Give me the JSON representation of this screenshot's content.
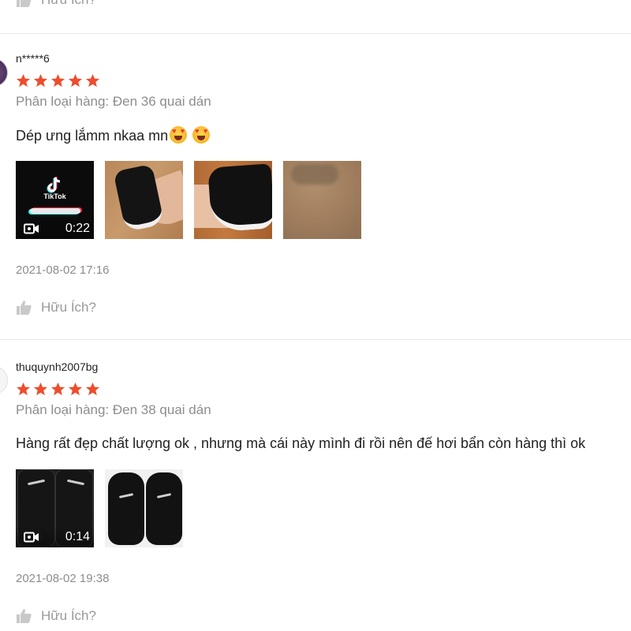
{
  "helpful_label": "Hữu Ích?",
  "reviews": [
    {
      "username": "n*****6",
      "rating": 5,
      "variant": "Phân loại hàng: Đen 36 quai dán",
      "comment": "Dép ưng lắmm nkaa mn",
      "media": [
        {
          "kind": "video",
          "duration": "0:22",
          "logo_text": "TikTok"
        },
        {
          "kind": "photo"
        },
        {
          "kind": "photo"
        },
        {
          "kind": "photo"
        }
      ],
      "date": "2021-08-02 17:16"
    },
    {
      "username": "thuquynh2007bg",
      "rating": 5,
      "variant": "Phân loại hàng: Đen 38 quai dán",
      "comment": "Hàng rất đẹp chất lượng ok , nhưng mà cái này mình đi rồi nên đế hơi bẩn còn hàng thì ok",
      "media": [
        {
          "kind": "video",
          "duration": "0:14"
        },
        {
          "kind": "photo"
        }
      ],
      "date": "2021-08-02 19:38"
    }
  ],
  "colors": {
    "star": "#ee4d2d",
    "muted_text": "#8d8d8d",
    "divider": "#e8e8e8"
  }
}
